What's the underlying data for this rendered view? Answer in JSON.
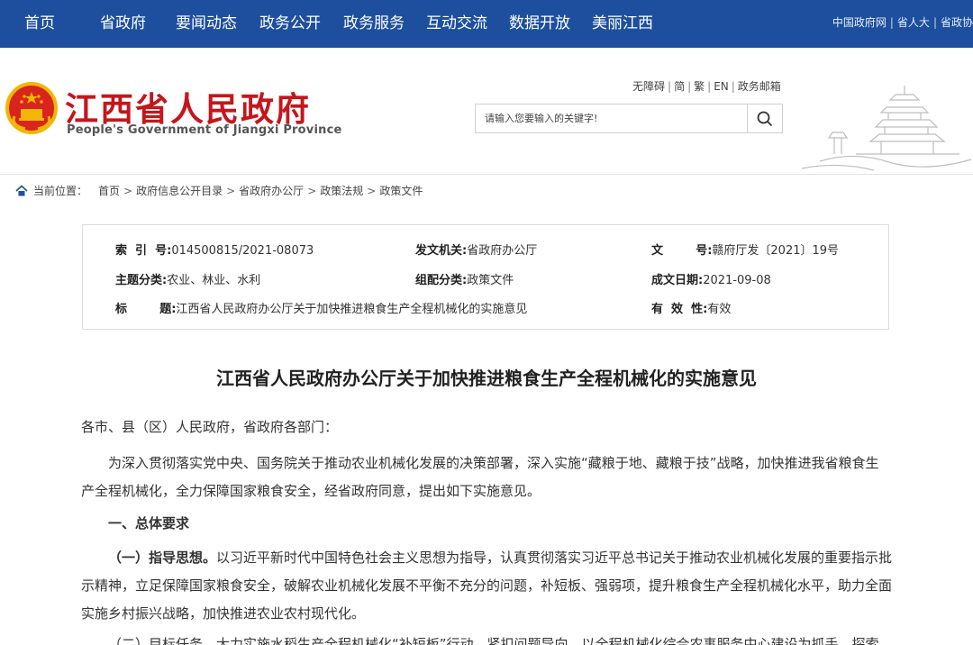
{
  "nav": {
    "items": [
      "首页",
      "省政府",
      "要闻动态",
      "政务公开",
      "政务服务",
      "互动交流",
      "数据开放",
      "美丽江西"
    ],
    "links": [
      "中国政府网",
      "省人大",
      "省政协"
    ]
  },
  "header": {
    "title": "江西省人民政府",
    "subtitle": "People's Government of Jiangxi Province",
    "util_links": [
      "无障碍",
      "简",
      "繁",
      "EN",
      "政务邮箱"
    ],
    "search_placeholder": "请输入您要输入的关键字!"
  },
  "breadcrumb": {
    "label": "当前位置：",
    "items": [
      "首页",
      "政府信息公开目录",
      "省政府办公厅",
      "政策法规",
      "政策文件"
    ]
  },
  "meta": {
    "index_label": "索  引  号:",
    "index_value": "014500815/2021-08073",
    "issuer_label": "发文机关:",
    "issuer_value": "省政府办公厅",
    "docno_label": "文        号:",
    "docno_value": "赣府厅发〔2021〕19号",
    "topic_label": "主题分类:",
    "topic_value": "农业、林业、水利",
    "category_label": "组配分类:",
    "category_value": "政策文件",
    "date_label": "成文日期:",
    "date_value": "2021-09-08",
    "title_label": "标        题:",
    "title_value": "江西省人民政府办公厅关于加快推进粮食生产全程机械化的实施意见",
    "valid_label": "有  效  性:",
    "valid_value": "有效"
  },
  "article": {
    "title": "江西省人民政府办公厅关于加快推进粮食生产全程机械化的实施意见",
    "salutation": "各市、县（区）人民政府，省政府各部门：",
    "p1_line1": "为深入贯彻落实党中央、国务院关于推动农业机械化发展的决策部署，深入实施“藏粮于地、藏粮于技”战略，加快推进我省粮食生",
    "p1_line2": "产全程机械化，全力保障国家粮食安全，经省政府同意，提出如下实施意见。",
    "section1": "一、总体要求",
    "guide_label": "（一）指导思想。",
    "guide_line1": "以习近平新时代中国特色社会主义思想为指导，认真贯彻落实习近平总书记关于推动农业机械化发展的重要指示批",
    "guide_line2": "示精神，立足保障国家粮食安全，破解农业机械化发展不平衡不充分的问题，补短板、强弱项，提升粮食生产全程机械化水平，助力全面",
    "guide_line3": "实施乡村振兴战略，加快推进农业农村现代化。",
    "goal_partial": "（二）目标任务。大力实施水稻生产全程机械化“补短板”行动，紧扣问题导向，以全程机械化综合农事服务中心建设为抓手，探索"
  },
  "colors": {
    "nav_bg": "#1d4f9e",
    "title_red": "#c4161c"
  }
}
